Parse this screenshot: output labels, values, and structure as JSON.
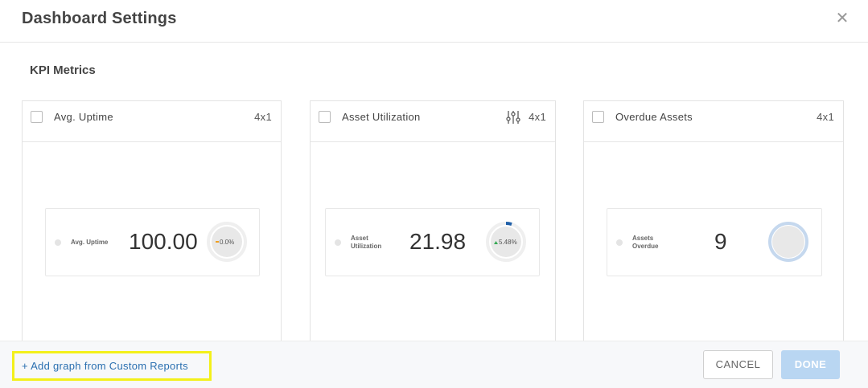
{
  "dialog": {
    "title": "Dashboard Settings"
  },
  "section": {
    "title": "KPI Metrics"
  },
  "cards": [
    {
      "label": "Avg. Uptime",
      "size": "4x1",
      "kpi_label_lines": [
        "Avg. Uptime"
      ],
      "value": "100.00",
      "change": "0.0%",
      "change_color": "#f0a020"
    },
    {
      "label": "Asset Utilization",
      "size": "4x1",
      "kpi_label_lines": [
        "Asset",
        "Utilization"
      ],
      "value": "21.98",
      "change": "5.48%",
      "change_color": "#34a853",
      "ring_accent": "#1f5fa8"
    },
    {
      "label": "Overdue Assets",
      "size": "4x1",
      "kpi_label_lines": [
        "Assets",
        "Overdue"
      ],
      "value": "9",
      "ring_color": "#c5d8ee"
    }
  ],
  "footer": {
    "add_link": "+ Add graph from Custom Reports",
    "cancel": "CANCEL",
    "done": "DONE"
  },
  "colors": {
    "accent": "#2a6fb0",
    "highlight": "#f3f01a",
    "done_disabled": "#b9d6f2"
  }
}
